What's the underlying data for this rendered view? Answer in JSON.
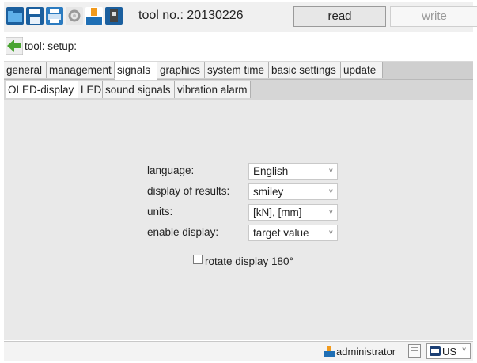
{
  "toolbar": {
    "icons": [
      "folder-icon",
      "save-icon",
      "print-icon",
      "gear-icon",
      "user-icon",
      "device-icon"
    ],
    "tool_no": "tool no.: 20130226",
    "read_label": "read",
    "write_label": "write"
  },
  "breadcrumb": {
    "text": "tool: setup:"
  },
  "tabs_main": [
    {
      "label": "general",
      "active": false
    },
    {
      "label": "management",
      "active": false
    },
    {
      "label": "signals",
      "active": true
    },
    {
      "label": "graphics",
      "active": false
    },
    {
      "label": "system time",
      "active": false
    },
    {
      "label": "basic settings",
      "active": false
    },
    {
      "label": "update",
      "active": false
    }
  ],
  "tabs_sub": [
    {
      "label": "OLED-display",
      "active": true
    },
    {
      "label": "LED",
      "active": false
    },
    {
      "label": "sound signals",
      "active": false
    },
    {
      "label": "vibration alarm",
      "active": false
    }
  ],
  "form": {
    "fields": [
      {
        "label": "language:",
        "value": "English"
      },
      {
        "label": "display of results:",
        "value": "smiley"
      },
      {
        "label": "units:",
        "value": "[kN], [mm]"
      },
      {
        "label": "enable display:",
        "value": "target value"
      }
    ],
    "rotate_label": "rotate display 180°",
    "rotate_checked": false
  },
  "statusbar": {
    "user": "administrator",
    "language": "US"
  },
  "colors": {
    "accent_blue": "#1f6fb5",
    "accent_orange": "#f29a1c",
    "accent_green": "#4aa432",
    "content_bg": "#e9e9e9"
  }
}
